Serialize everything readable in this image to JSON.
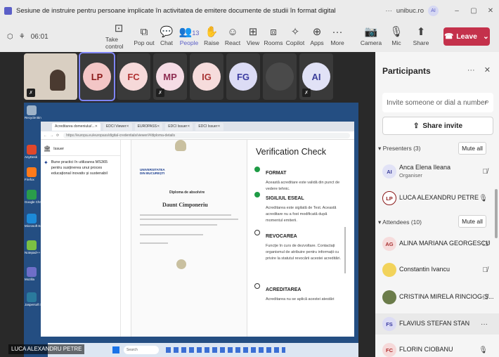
{
  "window": {
    "title": "Sesiune de instruire pentru persoane implicate în activitatea de emitere documente de studii în format digital",
    "org": "unibuc.ro",
    "account_initials": "AI",
    "controls": [
      "–",
      "▢",
      "✕"
    ]
  },
  "toolbar": {
    "timer": "06:01",
    "buttons": [
      {
        "label": "Take control",
        "icon": "⊡"
      },
      {
        "label": "Pop out",
        "icon": "⧉"
      },
      {
        "label": "Chat",
        "icon": "💬"
      },
      {
        "label": "People",
        "icon": "👥",
        "count": "13"
      },
      {
        "label": "Raise",
        "icon": "✋"
      },
      {
        "label": "React",
        "icon": "☺"
      },
      {
        "label": "View",
        "icon": "⊞"
      },
      {
        "label": "Rooms",
        "icon": "⧈"
      },
      {
        "label": "Copilot",
        "icon": "✧"
      },
      {
        "label": "Apps",
        "icon": "⊕"
      },
      {
        "label": "More",
        "icon": "···"
      }
    ],
    "media": [
      {
        "label": "Camera",
        "icon": "📷"
      },
      {
        "label": "Mic",
        "icon": "🎙"
      },
      {
        "label": "Share",
        "icon": "⬆"
      }
    ],
    "leave_label": "Leave"
  },
  "stage": {
    "tiles": [
      {
        "initials": "",
        "video": true
      },
      {
        "initials": "LP",
        "bg": "#f3c6c6",
        "fg": "#8b1a1a",
        "active": true
      },
      {
        "initials": "FC",
        "bg": "#f6d9d9",
        "fg": "#b03030"
      },
      {
        "initials": "MP",
        "bg": "#f5dce5",
        "fg": "#8f2e53"
      },
      {
        "initials": "IG",
        "bg": "#f6dcdc",
        "fg": "#a83232"
      },
      {
        "initials": "FG",
        "bg": "#dcdcf5",
        "fg": "#3a3aa0"
      },
      {
        "initials": "",
        "bg": "#3a3a3a",
        "fg": "#3a3a3a"
      },
      {
        "initials": "AI",
        "bg": "#e1e2f6",
        "fg": "#3b3e99"
      }
    ],
    "presenter_name": "LUCA ALEXANDRU PETRE"
  },
  "shared": {
    "desktop_labels": [
      "Recycle Bin",
      "AnyDesk",
      "Firefox",
      "Google Chrome",
      "Microsoft Edge",
      "Notepad++",
      "Mozilla",
      "Jaspersoft Studio"
    ],
    "browser_tabs": [
      "Acreditarea domeniului/...",
      "EDCI Viewer",
      "EUROPASS",
      "EDCI Issuer",
      "EDCI Issuer"
    ],
    "url": "https://europa.eu/europass/digital-credentials/viewer/#/diploma-details",
    "left_panel": {
      "header": "Issuer",
      "item": "Bune practici în utilizarea MS365 pentru susținerea unui proces educațional inovativ și sustenabil"
    },
    "diploma": {
      "university": "UNIVERSITATEA DIN BUCUREȘTI",
      "subtitle": "Diploma de absolvire",
      "holder": "Daunt Cimponeriu"
    },
    "verification": {
      "title": "Verification Check",
      "items": [
        {
          "title": "FORMAT",
          "desc": "Această acreditare este validă din punct de vedere tehnic.",
          "status": "ok"
        },
        {
          "title": "SIGILIUL ESEAL",
          "desc": "Acreditarea este sigilată de Test. Această acreditare nu a fost modificată după momentul emiterii.",
          "status": "ok"
        },
        {
          "title": "REVOCAREA",
          "desc": "Funcție în curs de dezvoltare. Contactați organismul de atribuire pentru informații cu privire la statutul revocării acestei acreditări.",
          "status": "pending"
        },
        {
          "title": "ACREDITAREA",
          "desc": "Acreditarea nu se aplică acestei atestări",
          "status": "pending"
        }
      ]
    },
    "taskbar_search": "Search"
  },
  "participants": {
    "title": "Participants",
    "invite_placeholder": "Invite someone or dial a number",
    "share_invite": "Share invite",
    "presenters_label": "Presenters (3)",
    "attendees_label": "Attendees (10)",
    "mute_all": "Mute all",
    "presenters": [
      {
        "name": "Anca Elena Ileana",
        "role": "Organiser",
        "initials": "AI",
        "bg": "#e1e2f6",
        "fg": "#3b3e99",
        "action": "🎙̸"
      },
      {
        "name": "LUCA ALEXANDRU PETRE",
        "role": "",
        "initials": "LP",
        "bg": "#ffffff",
        "fg": "#8b1a1a",
        "action": "🎙"
      }
    ],
    "attendees": [
      {
        "name": "ALINA MARIANA GEORGESCU",
        "initials": "AG",
        "bg": "#f6dcdc",
        "fg": "#a83232",
        "action": "🎙̸"
      },
      {
        "name": "Constantin Ivancu",
        "initials": "",
        "bg": "#f2d35b",
        "fg": "#7a5c00",
        "action": "🎙̸"
      },
      {
        "name": "CRISTINA MIRELA RINCIOG-S...",
        "initials": "",
        "bg": "#6b7c4a",
        "fg": "#fff",
        "action": "🎙̸"
      },
      {
        "name": "FLAVIUS STEFAN STAN",
        "initials": "FS",
        "bg": "#dcdcf5",
        "fg": "#3a3aa0",
        "action": "···",
        "highlight": true
      },
      {
        "name": "FLORIN CIOBANU",
        "initials": "FC",
        "bg": "#f6d9d9",
        "fg": "#b03030",
        "action": "🎙"
      }
    ]
  }
}
